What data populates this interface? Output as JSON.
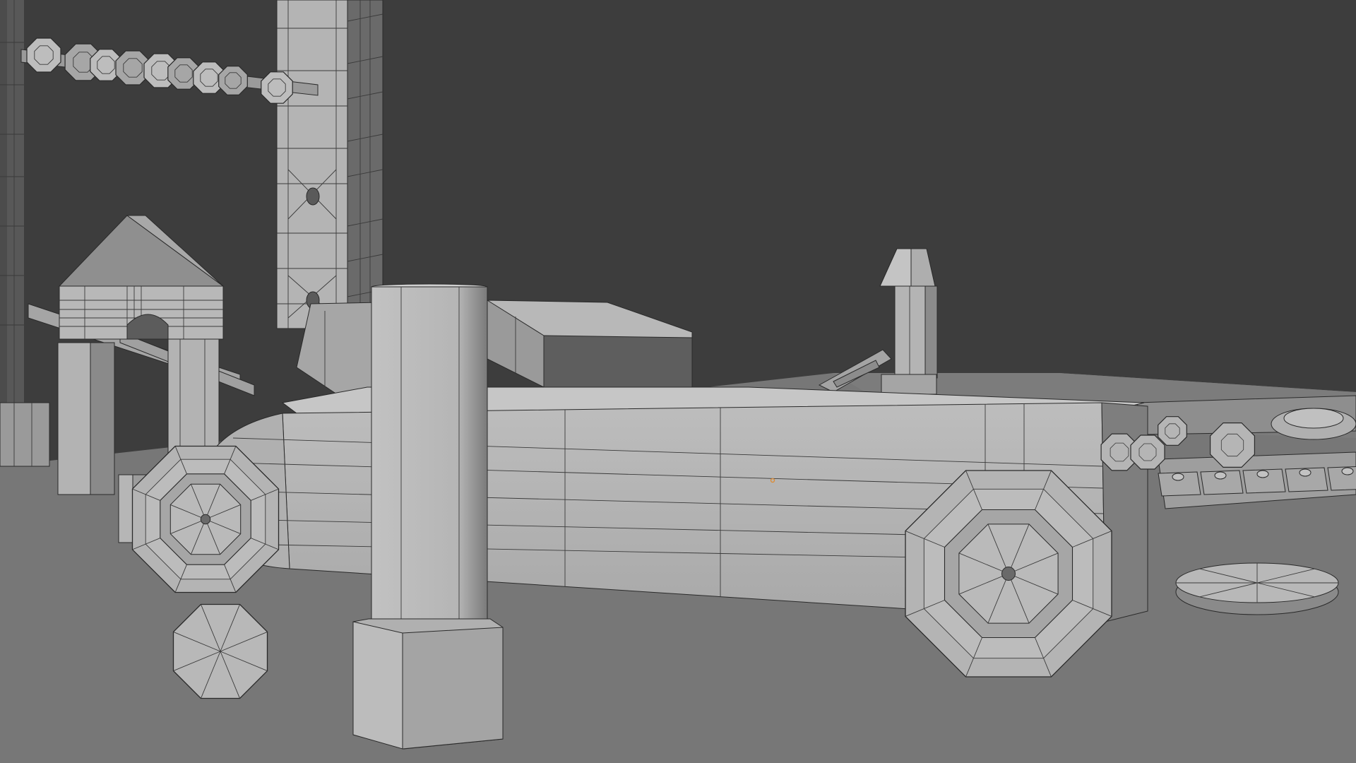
{
  "viewport": {
    "type": "3d-viewport",
    "shading": "solid",
    "overlay": "wireframe",
    "colors": {
      "background": "#3d3d3d",
      "ground": "#777777",
      "mesh_light": "#c4c4c4",
      "mesh_mid": "#a9a9a9",
      "mesh_dark": "#8a8a8a",
      "wire": "#2a2a2a",
      "origin_marker": "#e08a2e"
    },
    "objects": [
      "scaffold-tower-left",
      "scaffold-tower-right",
      "abacus-rod-beads",
      "archway-house",
      "center-pillar",
      "toy-car-body",
      "car-cabin",
      "exhaust-chimney",
      "front-wheel",
      "rear-wheel",
      "small-wheel",
      "crane-arm",
      "track-plates",
      "round-disc",
      "origin-point"
    ]
  }
}
